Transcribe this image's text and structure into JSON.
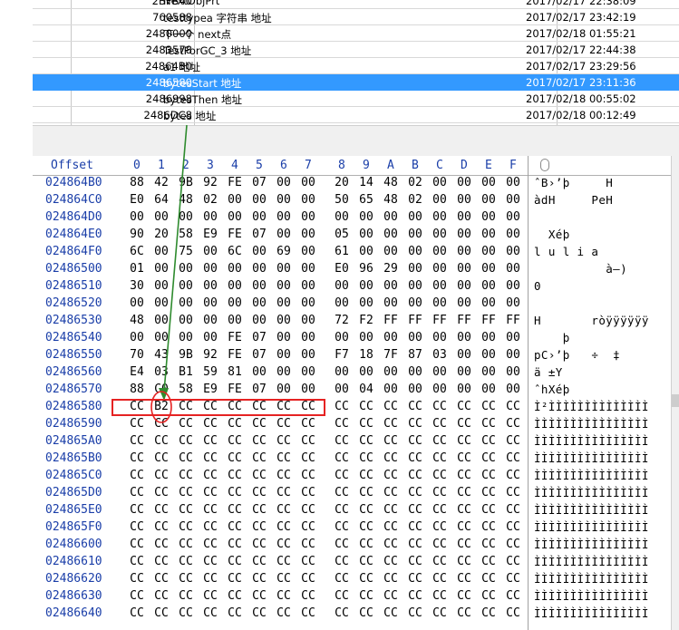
{
  "bookmarks": [
    {
      "addr": "2BFB40",
      "name": "NextObjPrt",
      "date": "2017/02/17   22:38:09"
    },
    {
      "addr": "760588",
      "name": "testtypea 字符串 地址",
      "date": "2017/02/17   23:42:19"
    },
    {
      "addr": "2480000",
      "name": "下一个 next点",
      "date": "2017/02/18   01:55:21"
    },
    {
      "addr": "2483578",
      "name": "TestForGC_3 地址",
      "date": "2017/02/17   22:44:38"
    },
    {
      "addr": "24864B0",
      "name": "a1 地址",
      "date": "2017/02/17   23:29:56"
    },
    {
      "addr": "2486580",
      "name": "bytesStart 地址",
      "date": "2017/02/17   23:11:36",
      "selected": true
    },
    {
      "addr": "2486998",
      "name": "bytesThen 地址",
      "date": "2017/02/18   00:55:02"
    },
    {
      "addr": "2486DC8",
      "name": "bytes 地址",
      "date": "2017/02/18   00:12:49"
    }
  ],
  "hex_header": {
    "offset_label": "Offset",
    "cols": [
      "0",
      "1",
      "2",
      "3",
      "4",
      "5",
      "6",
      "7",
      "8",
      "9",
      "A",
      "B",
      "C",
      "D",
      "E",
      "F"
    ]
  },
  "rows": [
    {
      "offset": "024864B0",
      "bytes": [
        "88",
        "42",
        "9B",
        "92",
        "FE",
        "07",
        "00",
        "00",
        "20",
        "14",
        "48",
        "02",
        "00",
        "00",
        "00",
        "00"
      ],
      "ascii": "ˆB›’þ     H"
    },
    {
      "offset": "024864C0",
      "bytes": [
        "E0",
        "64",
        "48",
        "02",
        "00",
        "00",
        "00",
        "00",
        "50",
        "65",
        "48",
        "02",
        "00",
        "00",
        "00",
        "00"
      ],
      "ascii": "àdH     PeH"
    },
    {
      "offset": "024864D0",
      "bytes": [
        "00",
        "00",
        "00",
        "00",
        "00",
        "00",
        "00",
        "00",
        "00",
        "00",
        "00",
        "00",
        "00",
        "00",
        "00",
        "00"
      ],
      "ascii": ""
    },
    {
      "offset": "024864E0",
      "bytes": [
        "90",
        "20",
        "58",
        "E9",
        "FE",
        "07",
        "00",
        "00",
        "05",
        "00",
        "00",
        "00",
        "00",
        "00",
        "00",
        "00"
      ],
      "ascii": "  Xéþ"
    },
    {
      "offset": "024864F0",
      "bytes": [
        "6C",
        "00",
        "75",
        "00",
        "6C",
        "00",
        "69",
        "00",
        "61",
        "00",
        "00",
        "00",
        "00",
        "00",
        "00",
        "00"
      ],
      "ascii": "l u l i a"
    },
    {
      "offset": "02486500",
      "bytes": [
        "01",
        "00",
        "00",
        "00",
        "00",
        "00",
        "00",
        "00",
        "E0",
        "96",
        "29",
        "00",
        "00",
        "00",
        "00",
        "00"
      ],
      "ascii": "          à–)"
    },
    {
      "offset": "02486510",
      "bytes": [
        "30",
        "00",
        "00",
        "00",
        "00",
        "00",
        "00",
        "00",
        "00",
        "00",
        "00",
        "00",
        "00",
        "00",
        "00",
        "00"
      ],
      "ascii": "0"
    },
    {
      "offset": "02486520",
      "bytes": [
        "00",
        "00",
        "00",
        "00",
        "00",
        "00",
        "00",
        "00",
        "00",
        "00",
        "00",
        "00",
        "00",
        "00",
        "00",
        "00"
      ],
      "ascii": ""
    },
    {
      "offset": "02486530",
      "bytes": [
        "48",
        "00",
        "00",
        "00",
        "00",
        "00",
        "00",
        "00",
        "72",
        "F2",
        "FF",
        "FF",
        "FF",
        "FF",
        "FF",
        "FF"
      ],
      "ascii": "H       ròÿÿÿÿÿÿ"
    },
    {
      "offset": "02486540",
      "bytes": [
        "00",
        "00",
        "00",
        "00",
        "FE",
        "07",
        "00",
        "00",
        "00",
        "00",
        "00",
        "00",
        "00",
        "00",
        "00",
        "00"
      ],
      "ascii": "    þ"
    },
    {
      "offset": "02486550",
      "bytes": [
        "70",
        "43",
        "9B",
        "92",
        "FE",
        "07",
        "00",
        "00",
        "F7",
        "18",
        "7F",
        "87",
        "03",
        "00",
        "00",
        "00"
      ],
      "ascii": "pC›’þ   ÷  ‡"
    },
    {
      "offset": "02486560",
      "bytes": [
        "E4",
        "03",
        "B1",
        "59",
        "81",
        "00",
        "00",
        "00",
        "00",
        "00",
        "00",
        "00",
        "00",
        "00",
        "00",
        "00"
      ],
      "ascii": "ä ±Y"
    },
    {
      "offset": "02486570",
      "bytes": [
        "88",
        "C0",
        "58",
        "E9",
        "FE",
        "07",
        "00",
        "00",
        "00",
        "04",
        "00",
        "00",
        "00",
        "00",
        "00",
        "00"
      ],
      "ascii": "ˆhXéþ"
    },
    {
      "offset": "02486580",
      "bytes": [
        "CC",
        "B2",
        "CC",
        "CC",
        "CC",
        "CC",
        "CC",
        "CC",
        "CC",
        "CC",
        "CC",
        "CC",
        "CC",
        "CC",
        "CC",
        "CC"
      ],
      "ascii": "Ì²ÌÌÌÌÌÌÌÌÌÌÌÌÌÌ"
    },
    {
      "offset": "02486590",
      "bytes": [
        "CC",
        "CC",
        "CC",
        "CC",
        "CC",
        "CC",
        "CC",
        "CC",
        "CC",
        "CC",
        "CC",
        "CC",
        "CC",
        "CC",
        "CC",
        "CC"
      ],
      "ascii": "ÌÌÌÌÌÌÌÌÌÌÌÌÌÌÌÌ"
    },
    {
      "offset": "024865A0",
      "bytes": [
        "CC",
        "CC",
        "CC",
        "CC",
        "CC",
        "CC",
        "CC",
        "CC",
        "CC",
        "CC",
        "CC",
        "CC",
        "CC",
        "CC",
        "CC",
        "CC"
      ],
      "ascii": "ÌÌÌÌÌÌÌÌÌÌÌÌÌÌÌÌ"
    },
    {
      "offset": "024865B0",
      "bytes": [
        "CC",
        "CC",
        "CC",
        "CC",
        "CC",
        "CC",
        "CC",
        "CC",
        "CC",
        "CC",
        "CC",
        "CC",
        "CC",
        "CC",
        "CC",
        "CC"
      ],
      "ascii": "ÌÌÌÌÌÌÌÌÌÌÌÌÌÌÌÌ"
    },
    {
      "offset": "024865C0",
      "bytes": [
        "CC",
        "CC",
        "CC",
        "CC",
        "CC",
        "CC",
        "CC",
        "CC",
        "CC",
        "CC",
        "CC",
        "CC",
        "CC",
        "CC",
        "CC",
        "CC"
      ],
      "ascii": "ÌÌÌÌÌÌÌÌÌÌÌÌÌÌÌÌ"
    },
    {
      "offset": "024865D0",
      "bytes": [
        "CC",
        "CC",
        "CC",
        "CC",
        "CC",
        "CC",
        "CC",
        "CC",
        "CC",
        "CC",
        "CC",
        "CC",
        "CC",
        "CC",
        "CC",
        "CC"
      ],
      "ascii": "ÌÌÌÌÌÌÌÌÌÌÌÌÌÌÌÌ"
    },
    {
      "offset": "024865E0",
      "bytes": [
        "CC",
        "CC",
        "CC",
        "CC",
        "CC",
        "CC",
        "CC",
        "CC",
        "CC",
        "CC",
        "CC",
        "CC",
        "CC",
        "CC",
        "CC",
        "CC"
      ],
      "ascii": "ÌÌÌÌÌÌÌÌÌÌÌÌÌÌÌÌ"
    },
    {
      "offset": "024865F0",
      "bytes": [
        "CC",
        "CC",
        "CC",
        "CC",
        "CC",
        "CC",
        "CC",
        "CC",
        "CC",
        "CC",
        "CC",
        "CC",
        "CC",
        "CC",
        "CC",
        "CC"
      ],
      "ascii": "ÌÌÌÌÌÌÌÌÌÌÌÌÌÌÌÌ"
    },
    {
      "offset": "02486600",
      "bytes": [
        "CC",
        "CC",
        "CC",
        "CC",
        "CC",
        "CC",
        "CC",
        "CC",
        "CC",
        "CC",
        "CC",
        "CC",
        "CC",
        "CC",
        "CC",
        "CC"
      ],
      "ascii": "ÌÌÌÌÌÌÌÌÌÌÌÌÌÌÌÌ"
    },
    {
      "offset": "02486610",
      "bytes": [
        "CC",
        "CC",
        "CC",
        "CC",
        "CC",
        "CC",
        "CC",
        "CC",
        "CC",
        "CC",
        "CC",
        "CC",
        "CC",
        "CC",
        "CC",
        "CC"
      ],
      "ascii": "ÌÌÌÌÌÌÌÌÌÌÌÌÌÌÌÌ"
    },
    {
      "offset": "02486620",
      "bytes": [
        "CC",
        "CC",
        "CC",
        "CC",
        "CC",
        "CC",
        "CC",
        "CC",
        "CC",
        "CC",
        "CC",
        "CC",
        "CC",
        "CC",
        "CC",
        "CC"
      ],
      "ascii": "ÌÌÌÌÌÌÌÌÌÌÌÌÌÌÌÌ"
    },
    {
      "offset": "02486630",
      "bytes": [
        "CC",
        "CC",
        "CC",
        "CC",
        "CC",
        "CC",
        "CC",
        "CC",
        "CC",
        "CC",
        "CC",
        "CC",
        "CC",
        "CC",
        "CC",
        "CC"
      ],
      "ascii": "ÌÌÌÌÌÌÌÌÌÌÌÌÌÌÌÌ"
    },
    {
      "offset": "02486640",
      "bytes": [
        "CC",
        "CC",
        "CC",
        "CC",
        "CC",
        "CC",
        "CC",
        "CC",
        "CC",
        "CC",
        "CC",
        "CC",
        "CC",
        "CC",
        "CC",
        "CC"
      ],
      "ascii": "ÌÌÌÌÌÌÌÌÌÌÌÌÌÌÌÌ"
    }
  ],
  "colors": {
    "offset_text": "#1a3ea8",
    "selection": "#3399ff",
    "annotation_red": "#e52222",
    "annotation_green": "#2e8b2e"
  },
  "icons": {
    "header_icon": "paperclip-icon"
  }
}
